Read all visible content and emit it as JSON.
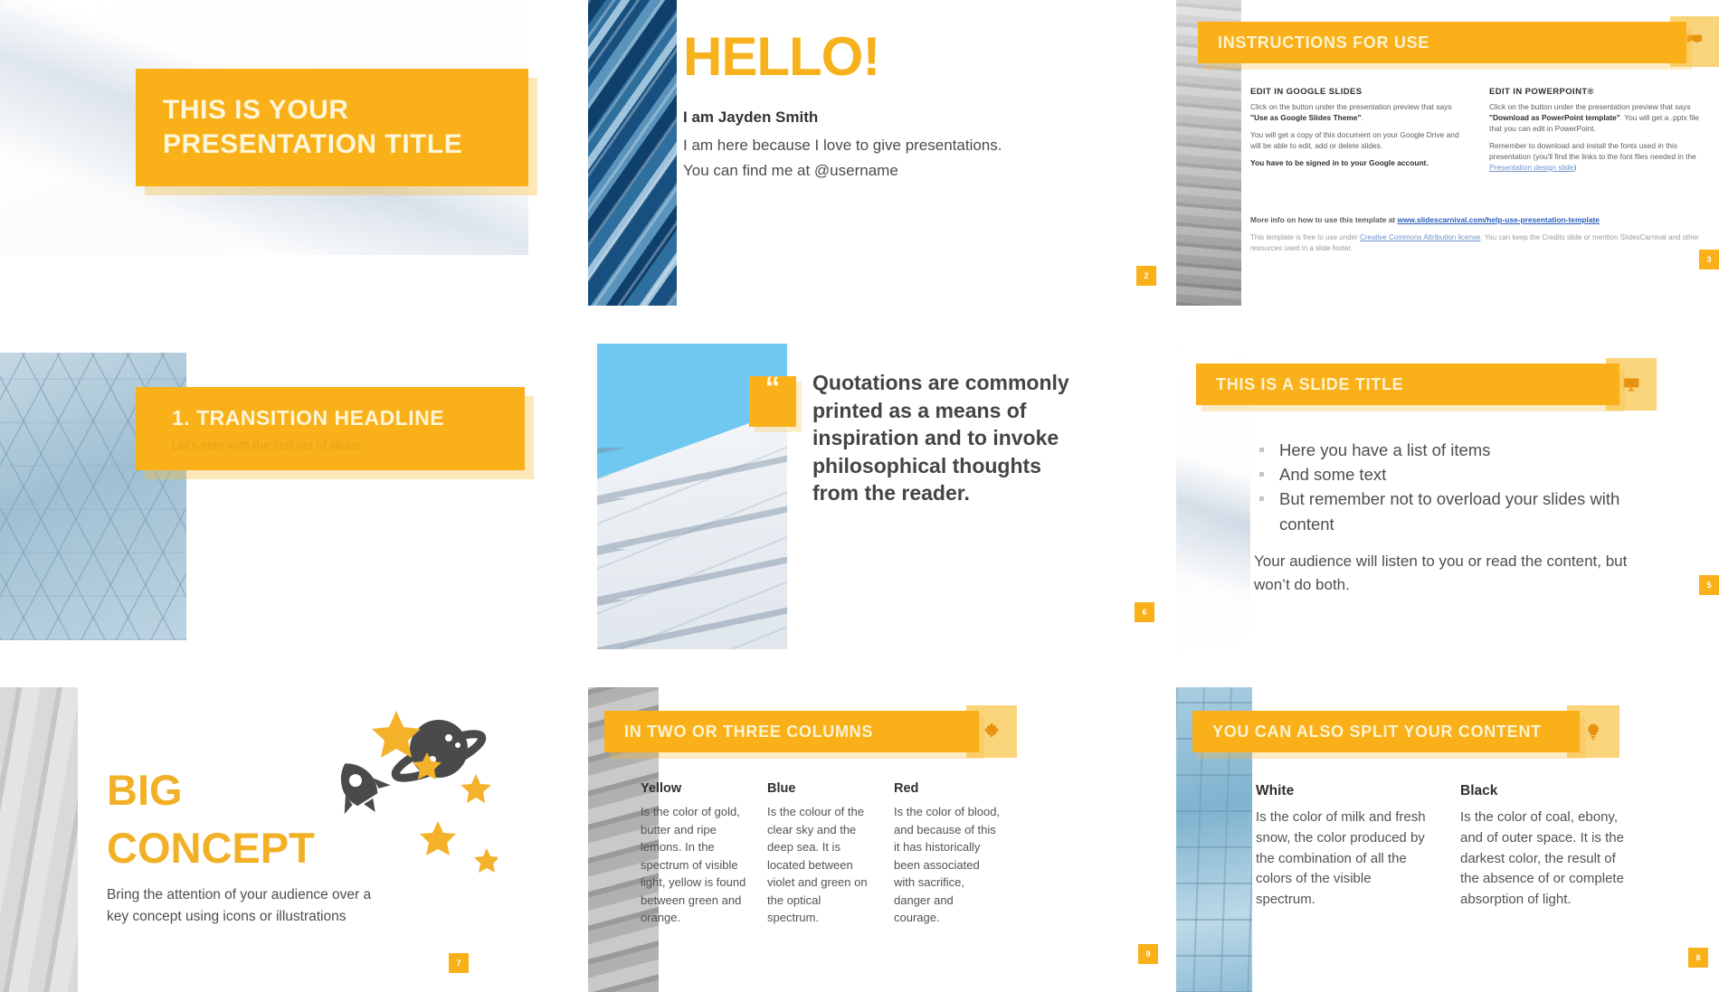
{
  "theme": {
    "accent": "#f9b019",
    "accent_light": "#fad47a",
    "title_text": "#fdf6d8",
    "body_text": "#4f4f4f"
  },
  "slides": [
    {
      "name": "title-slide",
      "title": "THIS IS YOUR PRESENTATION TITLE",
      "page": ""
    },
    {
      "name": "hello-slide",
      "heading": "HELLO!",
      "name_line": "I am Jayden Smith",
      "line2": "I am here because I love to give presentations.",
      "line3": "You can find me at @username",
      "page": "2"
    },
    {
      "name": "instructions-slide",
      "header": "INSTRUCTIONS FOR USE",
      "header_icon": "flag-icon",
      "col1": {
        "heading": "EDIT IN GOOGLE SLIDES",
        "p1_a": "Click on the button under the presentation preview that says ",
        "p1_b": "\"Use as Google Slides Theme\"",
        "p1_c": ".",
        "p2": "You will get a copy of this document on your Google Drive and will be able to edit, add or delete slides.",
        "p3": "You have to be signed in to your Google account."
      },
      "col2": {
        "heading": "EDIT IN POWERPOINT®",
        "p1_a": "Click on the button under the presentation preview that says ",
        "p1_b": "\"Download as PowerPoint template\"",
        "p1_c": ". You will get a .pptx file that you can edit in PowerPoint.",
        "p2_a": "Remember to download and install the fonts used in this presentation (you'll find the links to the font files needed in the ",
        "p2_link": "Presentation design slide",
        "p2_b": ")"
      },
      "footer1_a": "More info on how to use this template at ",
      "footer1_link": "www.slidescarnival.com/help-use-presentation-template",
      "footer2_a": "This template is free to use under ",
      "footer2_link": "Creative Commons Attribution license",
      "footer2_b": ". You can keep the Credits slide or mention SlidesCarnival and other resources used in a slide footer.",
      "page": "3"
    },
    {
      "name": "transition-slide",
      "title": "1. TRANSITION HEADLINE",
      "subtitle": "Let's start with the first set of slides",
      "page": ""
    },
    {
      "name": "quote-slide",
      "quote_mark": "“",
      "quote": "Quotations are commonly printed as a means of inspiration and to invoke philosophical thoughts from the reader.",
      "page": "6"
    },
    {
      "name": "slide-title-slide",
      "header": "THIS IS A SLIDE TITLE",
      "header_icon": "presentation-board-icon",
      "bullets": [
        "Here you have a list of items",
        "And some text",
        "But remember not to overload your slides with content"
      ],
      "note": "Your audience will listen to you or read the content, but won’t do both.",
      "page": "5"
    },
    {
      "name": "big-concept-slide",
      "line1": "BIG",
      "line2": "CONCEPT",
      "subtitle": "Bring the attention of your audience over a key concept using icons or illustrations",
      "art": [
        "rocket-icon",
        "planet-icon",
        "star-icon"
      ],
      "page": "7"
    },
    {
      "name": "three-columns-slide",
      "header": "IN TWO OR THREE COLUMNS",
      "header_icon": "puzzle-icon",
      "columns": [
        {
          "title": "Yellow",
          "text": "Is the color of gold, butter and ripe lemons. In the spectrum of visible light, yellow is found between green and orange."
        },
        {
          "title": "Blue",
          "text": "Is the colour of the clear sky and the deep sea. It is located between violet and green on the optical spectrum."
        },
        {
          "title": "Red",
          "text": "Is the color of blood, and because of this it has historically been associated with sacrifice, danger and courage."
        }
      ],
      "page": "9"
    },
    {
      "name": "split-content-slide",
      "header": "YOU CAN ALSO SPLIT YOUR CONTENT",
      "header_icon": "lightbulb-icon",
      "columns": [
        {
          "title": "White",
          "text": "Is the color of milk and fresh snow, the color produced by the combination of all the colors of the visible spectrum."
        },
        {
          "title": "Black",
          "text": "Is the color of coal, ebony, and of outer space. It is the darkest color, the result of the absence of or complete absorption of light."
        }
      ],
      "page": "8"
    }
  ]
}
